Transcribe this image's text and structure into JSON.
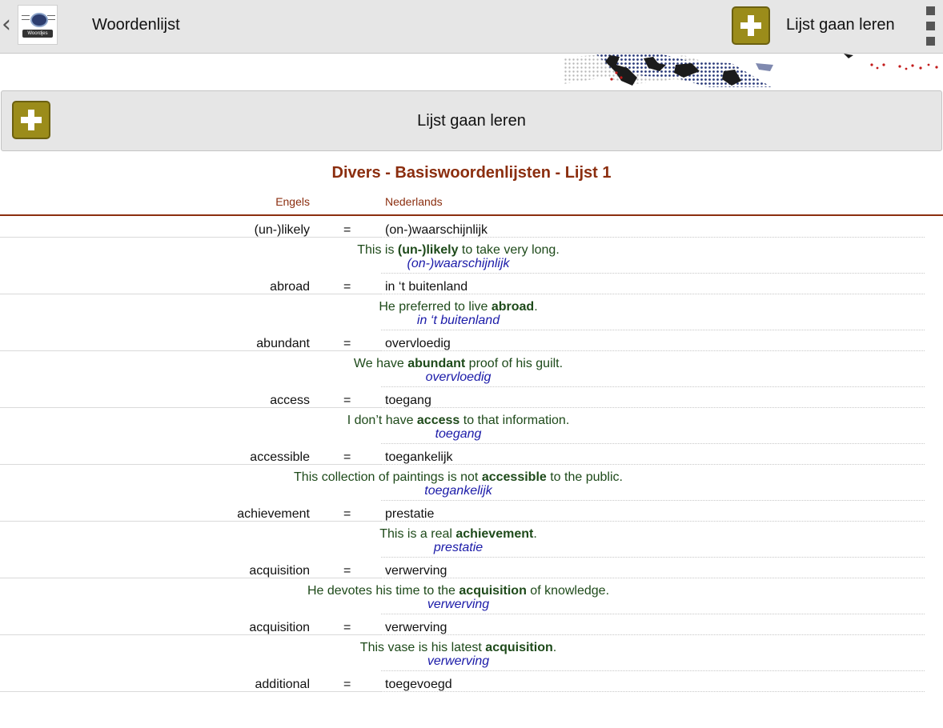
{
  "topbar": {
    "back_icon": "chevron-left-icon",
    "logo_text": "Woordjes",
    "title": "Woordenlijst",
    "learn_label": "Lijst gaan leren",
    "menu_icon": "more-vertical-icon",
    "accent_color": "#9b8c1a"
  },
  "learn_button": {
    "label": "Lijst gaan leren"
  },
  "list": {
    "title": "Divers - Basiswoordenlijsten - Lijst 1",
    "col_en": "Engels",
    "col_nl": "Nederlands",
    "separator": "=",
    "entries": [
      {
        "en": "(un-)likely",
        "nl": "(on-)waarschijnlijk",
        "pre": "This is ",
        "bold": "(un-)likely",
        "post": " to take very long.",
        "trans": "(on-)waarschijnlijk"
      },
      {
        "en": "abroad",
        "nl": "in ‘t buitenland",
        "pre": "He preferred to live ",
        "bold": "abroad",
        "post": ".",
        "trans": "in ‘t buitenland"
      },
      {
        "en": "abundant",
        "nl": "overvloedig",
        "pre": "We have ",
        "bold": "abundant",
        "post": " proof of his guilt.",
        "trans": "overvloedig"
      },
      {
        "en": "access",
        "nl": "toegang",
        "pre": "I don’t have ",
        "bold": "access",
        "post": " to that information.",
        "trans": "toegang"
      },
      {
        "en": "accessible",
        "nl": "toegankelijk",
        "pre": "This collection of paintings is not ",
        "bold": "accessible",
        "post": " to the public.",
        "trans": "toegankelijk"
      },
      {
        "en": "achievement",
        "nl": "prestatie",
        "pre": "This is a real ",
        "bold": "achievement",
        "post": ".",
        "trans": "prestatie"
      },
      {
        "en": "acquisition",
        "nl": "verwerving",
        "pre": "He devotes his time to the ",
        "bold": "acquisition",
        "post": " of knowledge.",
        "trans": "verwerving"
      },
      {
        "en": "acquisition",
        "nl": "verwerving",
        "pre": "This vase is his latest ",
        "bold": "acquisition",
        "post": ".",
        "trans": "verwerving"
      },
      {
        "en": "additional",
        "nl": "toegevoegd"
      }
    ]
  }
}
